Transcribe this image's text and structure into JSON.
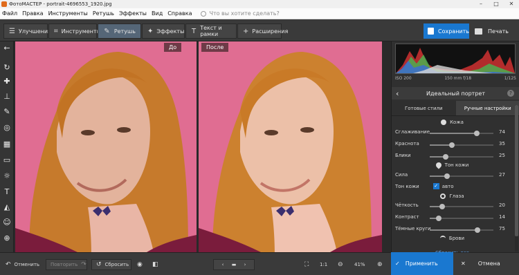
{
  "window": {
    "title": "ФотоМАСТЕР - portrait-4696553_1920.jpg"
  },
  "menu": [
    "Файл",
    "Правка",
    "Инструменты",
    "Ретушь",
    "Эффекты",
    "Вид",
    "Справка"
  ],
  "search": {
    "placeholder": "Что вы хотите сделать?"
  },
  "tabs": [
    {
      "label": "Улучшения",
      "icon": "sliders-icon"
    },
    {
      "label": "Инструменты",
      "icon": "crop-icon"
    },
    {
      "label": "Ретушь",
      "icon": "brush-icon",
      "active": true
    },
    {
      "label": "Эффекты",
      "icon": "magic-wand-icon"
    },
    {
      "label": "Текст и рамки",
      "icon": "text-icon"
    },
    {
      "label": "Расширения",
      "icon": "plus-icon"
    }
  ],
  "actions": {
    "save": "Сохранить",
    "print": "Печать"
  },
  "canvas": {
    "before_label": "До",
    "after_label": "После"
  },
  "exif": {
    "iso": "ISO 200",
    "lens": "150 mm f/18",
    "shutter": "1/125"
  },
  "panel": {
    "title": "Идеальный портрет",
    "tabs": [
      "Готовые стили",
      "Ручные настройки"
    ],
    "sections": {
      "skin": "Кожа",
      "skin_tone": "Тон кожи",
      "eyes": "Глаза",
      "brows": "Брови"
    },
    "skin_sliders": [
      {
        "label": "Сглаживание",
        "value": 74
      },
      {
        "label": "Краснота",
        "value": 35
      },
      {
        "label": "Блики",
        "value": 25
      }
    ],
    "tone_sliders": [
      {
        "label": "Сила",
        "value": 27
      }
    ],
    "tone_auto": {
      "label": "Тон кожи",
      "checkbox": "авто",
      "checked": true
    },
    "eye_sliders": [
      {
        "label": "Чёткость",
        "value": 20
      },
      {
        "label": "Контраст",
        "value": 14
      },
      {
        "label": "Тёмные круги",
        "value": 75
      }
    ],
    "reset_all": "Сбросить все"
  },
  "bottom": {
    "undo": "Отменить",
    "redo": "Повторить",
    "reset": "Сбросить",
    "ratio": "1:1",
    "zoom": "41%",
    "apply": "Применить",
    "cancel": "Отмена"
  },
  "colors": {
    "accent": "#1a78d0",
    "background_photo": "#e06d92"
  }
}
